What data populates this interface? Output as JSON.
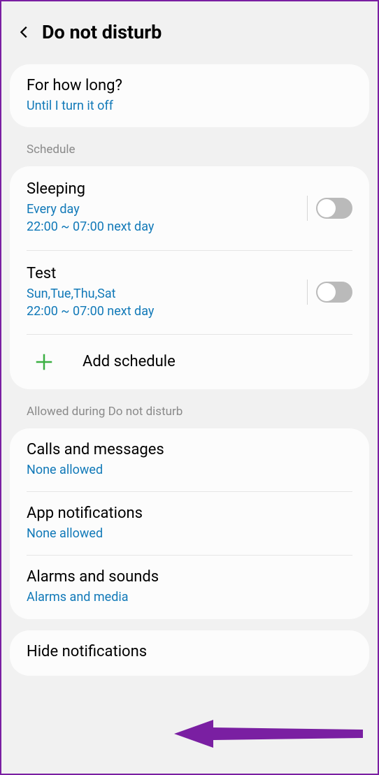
{
  "header": {
    "title": "Do not disturb"
  },
  "duration": {
    "label": "For how long?",
    "value": "Until I turn it off"
  },
  "section_schedule": "Schedule",
  "schedules": [
    {
      "name": "Sleeping",
      "days": "Every day",
      "time": "22:00 ~ 07:00 next day",
      "enabled": false
    },
    {
      "name": "Test",
      "days": "Sun,Tue,Thu,Sat",
      "time": "22:00 ~ 07:00 next day",
      "enabled": false
    }
  ],
  "add_schedule": "Add schedule",
  "section_allowed": "Allowed during Do not disturb",
  "allowed_items": [
    {
      "title": "Calls and messages",
      "status": "None allowed"
    },
    {
      "title": "App notifications",
      "status": "None allowed"
    },
    {
      "title": "Alarms and sounds",
      "status": "Alarms and media"
    }
  ],
  "hide_notifications": "Hide notifications",
  "colors": {
    "accent": "#1179b8",
    "plus": "#3cb043",
    "arrow": "#7a1fa2",
    "border": "#7a1fa2"
  }
}
